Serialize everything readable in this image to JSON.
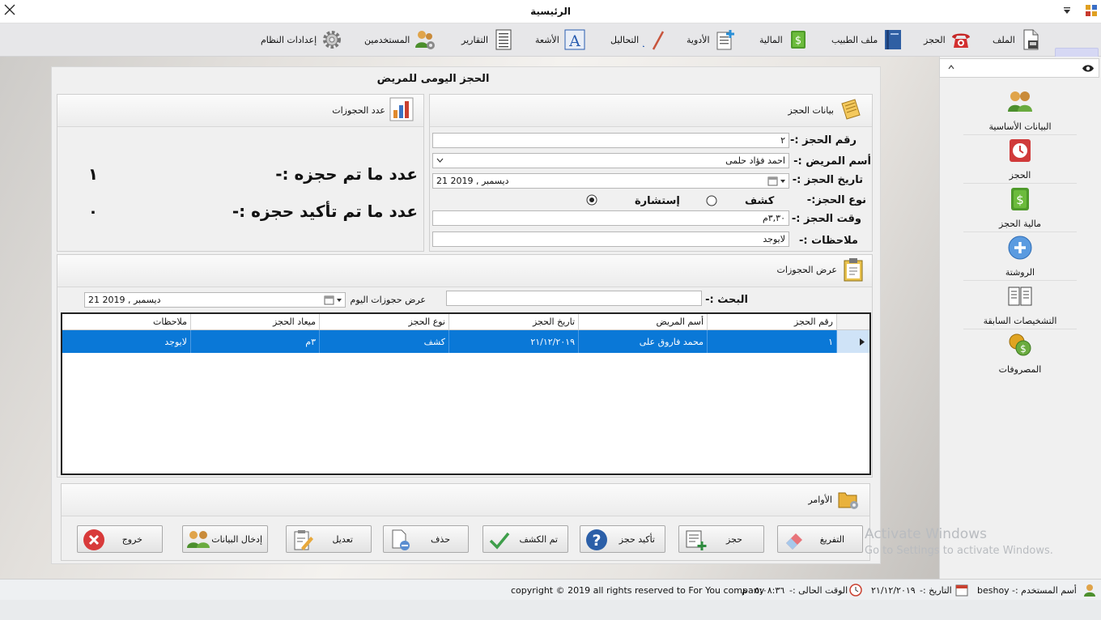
{
  "window": {
    "title": "الرئيسية"
  },
  "ribbon": {
    "items": [
      {
        "label": "الملف",
        "icon": "document-icon"
      },
      {
        "label": "الحجز",
        "icon": "telephone-icon"
      },
      {
        "label": "ملف الطبيب",
        "icon": "book-icon"
      },
      {
        "label": "المالية",
        "icon": "money-icon"
      },
      {
        "label": "الأدوية",
        "icon": "add-document-icon"
      },
      {
        "label": "التحاليل",
        "icon": "text-style-icon"
      },
      {
        "label": "الأشعة",
        "icon": "letter-a-icon"
      },
      {
        "label": "التقارير",
        "icon": "report-icon"
      },
      {
        "label": "المستخدمين",
        "icon": "users-settings-icon"
      },
      {
        "label": "إعدادات النظام",
        "icon": "gear-icon"
      }
    ]
  },
  "page": {
    "title": "الحجز اليومى للمريض"
  },
  "booking_panel": {
    "title": "بيانات الحجز",
    "number_label": "رقم الحجز :-",
    "number_value": "٢",
    "patient_label": "أسم المريض :-",
    "patient_value": "احمد فؤاد حلمى",
    "date_label": "تاريخ الحجز :-",
    "date_value": "21  ديسمبر , 2019",
    "type_label": "نوع الحجز:-",
    "type_options": [
      "كشف",
      "إستشارة"
    ],
    "type_selected": "إستشارة",
    "time_label": "وقت الحجز :-",
    "time_value": "٣,٣٠م",
    "notes_label": "ملاحظات :-",
    "notes_value": "لايوجد"
  },
  "count_panel": {
    "title": "عدد الحجوزات",
    "booked_label": "عدد ما تم حجزه :-",
    "booked_value": "١",
    "confirmed_label": "عدد ما تم تأكيد حجزه :-",
    "confirmed_value": "٠"
  },
  "list_panel": {
    "title": "عرض الحجوزات",
    "search_label": "البحث :-",
    "search_value": "",
    "today_label": "عرض حجوزات اليوم",
    "today_date": "21  ديسمبر , 2019",
    "columns": [
      "رقم الحجز",
      "أسم المريض",
      "تاريخ الحجز",
      "نوع الحجز",
      "ميعاد الحجز",
      "ملاحظات"
    ],
    "rows": [
      [
        "١",
        "محمد فاروق على",
        "٢١/١٢/٢٠١٩",
        "كشف",
        "٣م",
        "لايوجد"
      ]
    ]
  },
  "commands_panel": {
    "title": "الأوامر",
    "buttons": {
      "clear": "التفريغ",
      "book": "حجز",
      "confirm": "تأكيد حجز",
      "examined": "تم الكشف",
      "delete": "حذف",
      "edit": "تعديل",
      "data_entry": "إدخال البيانات",
      "exit": "خروج"
    }
  },
  "sidebar": {
    "items": [
      {
        "label": "البيانات الأساسية",
        "icon": "users-icon"
      },
      {
        "label": "الحجز",
        "icon": "clock-icon"
      },
      {
        "label": "مالية الحجز",
        "icon": "money-icon"
      },
      {
        "label": "الروشتة",
        "icon": "plus-circle-icon"
      },
      {
        "label": "التشخيصات السابقة",
        "icon": "open-book-icon"
      },
      {
        "label": "المصروفات",
        "icon": "coins-icon"
      }
    ]
  },
  "status": {
    "user_label": "أسم المستخدم :-",
    "user_value": "beshoy",
    "date_label": "التاريخ :-",
    "date_value": "٢١/١٢/٢٠١٩",
    "time_label": "الوقت الحالى :-",
    "time_value": "٠٥:٠٨:٣٦ م",
    "copyright": "copyright © 2019 all rights reserved to For You company"
  },
  "watermark": {
    "line1": "Activate Windows",
    "line2": "Go to Settings to activate Windows."
  },
  "colors": {
    "selection": "#0a78d7",
    "ribbon_bg": "#e7e7e9",
    "app_menu": "#d6d8f4"
  }
}
